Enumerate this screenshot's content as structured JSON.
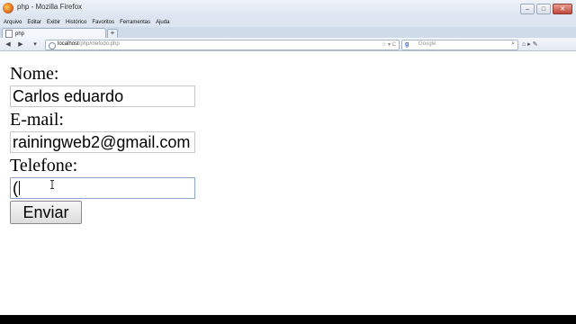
{
  "window": {
    "title": "php - Mozilla Firefox",
    "minimize_label": "–",
    "maximize_label": "□",
    "close_label": "✕"
  },
  "menu": [
    "Arquivo",
    "Editar",
    "Exibir",
    "Histórico",
    "Favoritos",
    "Ferramentas",
    "Ajuda"
  ],
  "tab": {
    "title": "php",
    "new_tab_label": "+"
  },
  "nav": {
    "back_label": "◀",
    "forward_label": "▶",
    "url_host": "localhost",
    "url_path": "/php/metodo.php",
    "url_right_icons": "☆ ▾ C",
    "search_placeholder": "Google",
    "search_engine_label": "g",
    "search_icon": "⌕",
    "home_icon": "⌂",
    "tool_icons": "⌂  ▸  ✎"
  },
  "form": {
    "nome_label": "Nome:",
    "nome_value": "Carlos eduardo",
    "email_label": "E-mail:",
    "email_value": "rainingweb2@gmail.com",
    "telefone_label": "Telefone:",
    "telefone_value": "(",
    "submit_label": "Enviar"
  }
}
